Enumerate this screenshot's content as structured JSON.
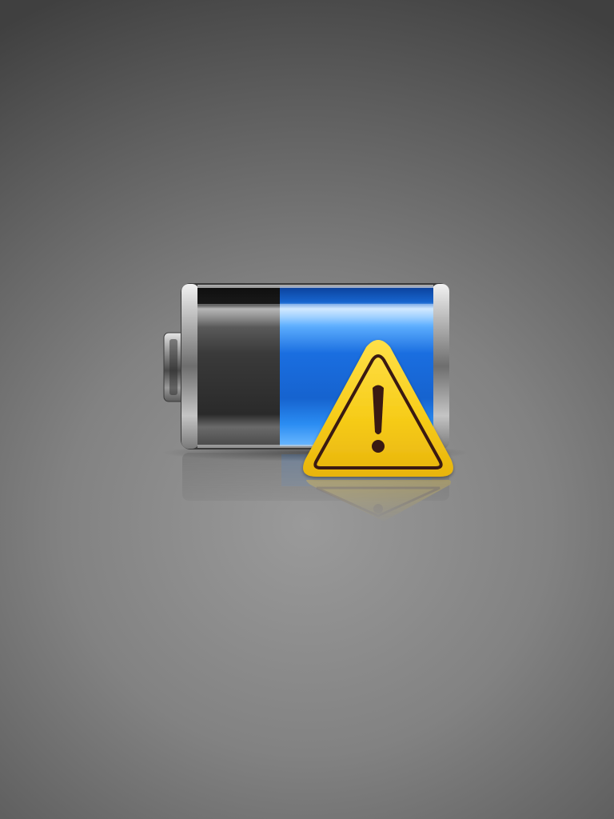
{
  "battery": {
    "charge_fraction": 0.65,
    "fill_color": "#1a74e8",
    "empty_color": "#2e2e2e"
  },
  "warning": {
    "fill_color": "#f7cd1a",
    "stroke_color": "#3a1a12",
    "icon": "warning-icon"
  },
  "background": {
    "center_color": "#9a9a9a",
    "edge_color": "#404040"
  }
}
